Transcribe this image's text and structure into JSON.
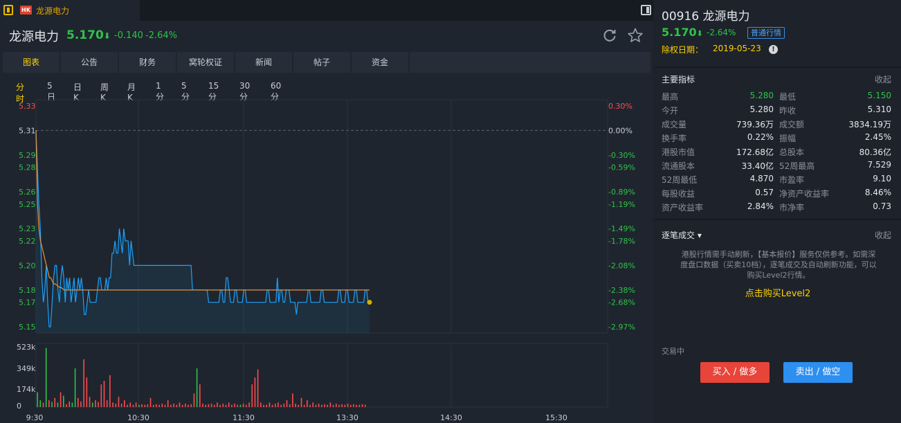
{
  "tab": {
    "badge": "HK",
    "title": "龙源电力"
  },
  "quote": {
    "name": "龙源电力",
    "price": "5.170",
    "arrow": "⬇",
    "change": "-0.140",
    "pct": "-2.64%"
  },
  "tabs": [
    "图表",
    "公告",
    "财务",
    "窝轮权证",
    "新闻",
    "帖子",
    "资金"
  ],
  "active_tab": 0,
  "periods": [
    "分时",
    "5日",
    "日K",
    "周K",
    "月K",
    "1分",
    "5分",
    "15分",
    "30分",
    "60分"
  ],
  "active_period": 0,
  "right": {
    "title": "00916 龙源电力",
    "price": "5.170",
    "arrow": "⬇",
    "pct": "-2.64%",
    "badge": "普通行情",
    "exdate_label": "除权日期：",
    "exdate": "2019-05-23",
    "info_icon": "!",
    "metrics_title": "主要指标",
    "collapse": "收起",
    "metrics": [
      [
        "最高",
        "5.280",
        "最低",
        "5.150"
      ],
      [
        "今开",
        "5.280",
        "昨收",
        "5.310"
      ],
      [
        "成交量",
        "739.36万",
        "成交额",
        "3834.19万"
      ],
      [
        "换手率",
        "0.22%",
        "振幅",
        "2.45%"
      ],
      [
        "港股市值",
        "172.68亿",
        "总股本",
        "80.36亿"
      ],
      [
        "流通股本",
        "33.40亿",
        "52周最高",
        "7.529"
      ],
      [
        "52周最低",
        "4.870",
        "市盈率",
        "9.10"
      ],
      [
        "每股收益",
        "0.57",
        "净资产收益率",
        "8.46%"
      ],
      [
        "资产收益率",
        "2.84%",
        "市净率",
        "0.73"
      ]
    ],
    "ticks_title": "逐笔成交",
    "ticks_caret": "▾",
    "ticks_collapse": "收起",
    "ticks_note": "港股行情需手动刷新，【基本报价】服务仅供参考。如需深度盘口数据（买卖10档），逐笔成交及自动刷新功能，可以购买Level2行情。",
    "buy_level2": "点击购买Level2",
    "trading": "交易中",
    "buy_btn": "买入 / 做多",
    "sell_btn": "卖出 / 做空"
  },
  "colors": {
    "up": "#ff4b4b",
    "down": "#2fc24a",
    "price_line": "#1aa3ff",
    "avg_line": "#e8913a",
    "highlight": "#ffd200"
  },
  "chart_data": {
    "type": "line",
    "price_axis": {
      "ticks": [
        "5.33",
        "5.31",
        "5.29",
        "5.28",
        "5.26",
        "5.25",
        "5.23",
        "5.22",
        "5.20",
        "5.18",
        "5.17",
        "5.15"
      ],
      "ylim": [
        5.145,
        5.335
      ]
    },
    "pct_axis": [
      "0.30%",
      "0.00%",
      "-0.30%",
      "-0.59%",
      "-0.89%",
      "-1.19%",
      "-1.49%",
      "-1.78%",
      "-2.08%",
      "-2.38%",
      "-2.68%",
      "-2.97%"
    ],
    "prev_close": 5.31,
    "time_axis": [
      "9:30",
      "10:30",
      "11:30",
      "13:30",
      "14:30",
      "15:30"
    ],
    "volume_axis": [
      "523k",
      "349k",
      "174k",
      "0"
    ],
    "volume_max": 523,
    "series": [
      {
        "values": [
          5.31,
          5.28,
          5.25,
          5.23,
          5.19,
          5.17,
          5.18,
          5.2,
          5.17,
          5.15,
          5.15,
          5.17,
          5.19,
          5.2,
          5.2,
          5.18,
          5.17,
          5.19,
          5.2,
          5.19,
          5.17,
          5.19,
          5.18,
          5.19,
          5.17,
          5.18,
          5.19,
          5.17,
          5.18,
          5.19,
          5.18,
          5.19,
          5.18,
          5.16,
          5.16,
          5.17,
          5.18,
          5.17,
          5.17,
          5.17,
          5.17,
          5.17,
          5.18,
          5.19,
          5.19,
          5.18,
          5.18,
          5.18,
          5.19,
          5.18,
          5.19,
          5.19,
          5.21,
          5.21,
          5.22,
          5.21,
          5.21,
          5.23,
          5.22,
          5.21,
          5.23,
          5.22,
          5.22,
          5.22,
          5.2,
          5.22,
          5.21,
          5.2,
          5.2,
          5.2,
          5.2,
          5.2,
          5.2,
          5.2,
          5.2,
          5.2,
          5.2,
          5.2,
          5.2,
          5.2,
          5.2,
          5.2,
          5.2,
          5.2,
          5.2,
          5.2,
          5.2,
          5.2,
          5.2,
          5.2,
          5.2,
          5.2,
          5.2,
          5.2,
          5.2,
          5.2,
          5.2,
          5.2,
          5.2,
          5.2,
          5.2,
          5.2,
          5.2,
          5.2,
          5.2,
          5.2,
          5.2,
          5.18,
          5.18,
          5.18,
          5.18,
          5.18,
          5.18,
          5.18,
          5.18,
          5.18,
          5.18,
          5.18,
          5.17,
          5.17,
          5.17,
          5.17,
          5.17,
          5.17,
          5.17,
          5.17,
          5.18,
          5.18,
          5.17,
          5.17,
          5.19,
          5.19,
          5.18,
          5.17,
          5.17,
          5.17,
          5.18,
          5.18,
          5.17,
          5.17,
          5.17,
          5.17,
          5.18,
          5.18,
          5.17,
          5.17,
          5.17,
          5.17,
          5.17,
          5.17,
          5.17,
          5.17,
          5.17,
          5.17,
          5.17,
          5.17,
          5.17,
          5.17,
          5.18,
          5.18,
          5.17,
          5.17,
          5.17,
          5.17,
          5.17,
          5.19,
          5.17,
          5.18,
          5.18,
          5.17,
          5.17,
          5.18,
          5.18,
          5.18,
          5.17,
          5.17,
          5.17,
          5.17,
          5.16,
          5.17,
          5.17,
          5.17,
          5.17,
          5.17,
          5.17,
          5.17,
          5.18,
          5.18,
          5.17,
          5.17,
          5.17,
          5.17,
          5.17,
          5.17,
          5.17,
          5.18,
          5.18,
          5.17,
          5.17,
          5.17,
          5.17,
          5.17,
          5.17,
          5.17,
          5.17,
          5.17,
          5.17,
          5.18,
          5.18,
          5.17,
          5.17,
          5.17,
          5.18,
          5.18,
          5.17,
          5.17,
          5.17,
          5.17,
          5.18,
          5.18,
          5.17,
          5.17,
          5.17,
          5.17,
          5.17,
          5.18,
          5.18,
          5.17,
          5.17
        ]
      },
      {
        "values": [
          5.31,
          5.25,
          5.23,
          5.22,
          5.215,
          5.21,
          5.205,
          5.2,
          5.195,
          5.19,
          5.19,
          5.187,
          5.185,
          5.185,
          5.184,
          5.183,
          5.182,
          5.182,
          5.181,
          5.18,
          5.18,
          5.18,
          5.18,
          5.18,
          5.18,
          5.18,
          5.18,
          5.18,
          5.18,
          5.18,
          5.18,
          5.18,
          5.18,
          5.18,
          5.18,
          5.18,
          5.18,
          5.18,
          5.18,
          5.18,
          5.18,
          5.18,
          5.18,
          5.18,
          5.18,
          5.18,
          5.18,
          5.18,
          5.18,
          5.18,
          5.18,
          5.18,
          5.18,
          5.18,
          5.18,
          5.18,
          5.18,
          5.18,
          5.18,
          5.18,
          5.18,
          5.18,
          5.18,
          5.18,
          5.18,
          5.18,
          5.18,
          5.18,
          5.18,
          5.18,
          5.18,
          5.18,
          5.18,
          5.18,
          5.18,
          5.18,
          5.18,
          5.18,
          5.18,
          5.18,
          5.18,
          5.18,
          5.18,
          5.18,
          5.18,
          5.18,
          5.18,
          5.18,
          5.18,
          5.18,
          5.18,
          5.18,
          5.18,
          5.18,
          5.18,
          5.18,
          5.18,
          5.18,
          5.18,
          5.18,
          5.18,
          5.18,
          5.18,
          5.18,
          5.18,
          5.18,
          5.18,
          5.18,
          5.18,
          5.18,
          5.18,
          5.18,
          5.18,
          5.18,
          5.18,
          5.18,
          5.18,
          5.18,
          5.18,
          5.18,
          5.18,
          5.18,
          5.18,
          5.18,
          5.18,
          5.18,
          5.18,
          5.18,
          5.18,
          5.18,
          5.18,
          5.18,
          5.18,
          5.18,
          5.18,
          5.18,
          5.18,
          5.18,
          5.18,
          5.18,
          5.18,
          5.18,
          5.18,
          5.18,
          5.18,
          5.18,
          5.18,
          5.18,
          5.18,
          5.18,
          5.18,
          5.18,
          5.18,
          5.18,
          5.18,
          5.18,
          5.18,
          5.18,
          5.18,
          5.18,
          5.18,
          5.18,
          5.18,
          5.18,
          5.18,
          5.18,
          5.18,
          5.18,
          5.18,
          5.18,
          5.18,
          5.18,
          5.18,
          5.18,
          5.18,
          5.18,
          5.18,
          5.18,
          5.18,
          5.18,
          5.18,
          5.18,
          5.18,
          5.18,
          5.18,
          5.18,
          5.18,
          5.18,
          5.18,
          5.18,
          5.18,
          5.18,
          5.18,
          5.18,
          5.18,
          5.18,
          5.18,
          5.18,
          5.18,
          5.18,
          5.18,
          5.18,
          5.18,
          5.18,
          5.18,
          5.18,
          5.18,
          5.18,
          5.18,
          5.18,
          5.18,
          5.18,
          5.18,
          5.18,
          5.18,
          5.18,
          5.18,
          5.18,
          5.18,
          5.18,
          5.18,
          5.18,
          5.18,
          5.18,
          5.18
        ]
      }
    ],
    "volume": [
      [
        1,
        130,
        "down"
      ],
      [
        3,
        60,
        "down"
      ],
      [
        5,
        40,
        "up"
      ],
      [
        7,
        520,
        "down"
      ],
      [
        9,
        60,
        "up"
      ],
      [
        11,
        45,
        "down"
      ],
      [
        13,
        80,
        "up"
      ],
      [
        15,
        40,
        "down"
      ],
      [
        17,
        130,
        "up"
      ],
      [
        19,
        100,
        "down"
      ],
      [
        21,
        25,
        "up"
      ],
      [
        23,
        50,
        "up"
      ],
      [
        25,
        40,
        "down"
      ],
      [
        27,
        340,
        "down"
      ],
      [
        29,
        80,
        "up"
      ],
      [
        31,
        50,
        "up"
      ],
      [
        33,
        420,
        "up"
      ],
      [
        35,
        260,
        "up"
      ],
      [
        37,
        90,
        "up"
      ],
      [
        39,
        40,
        "down"
      ],
      [
        41,
        60,
        "up"
      ],
      [
        43,
        45,
        "up"
      ],
      [
        45,
        200,
        "up"
      ],
      [
        47,
        230,
        "up"
      ],
      [
        49,
        60,
        "up"
      ],
      [
        51,
        280,
        "up"
      ],
      [
        53,
        40,
        "up"
      ],
      [
        55,
        30,
        "up"
      ],
      [
        57,
        90,
        "up"
      ],
      [
        59,
        30,
        "up"
      ],
      [
        61,
        60,
        "up"
      ],
      [
        63,
        20,
        "up"
      ],
      [
        65,
        40,
        "up"
      ],
      [
        67,
        20,
        "up"
      ],
      [
        69,
        40,
        "up"
      ],
      [
        71,
        20,
        "down"
      ],
      [
        73,
        25,
        "up"
      ],
      [
        75,
        20,
        "up"
      ],
      [
        77,
        25,
        "up"
      ],
      [
        79,
        80,
        "up"
      ],
      [
        81,
        20,
        "up"
      ],
      [
        83,
        25,
        "up"
      ],
      [
        85,
        20,
        "up"
      ],
      [
        87,
        30,
        "up"
      ],
      [
        89,
        20,
        "up"
      ],
      [
        91,
        60,
        "up"
      ],
      [
        93,
        20,
        "up"
      ],
      [
        95,
        30,
        "up"
      ],
      [
        97,
        20,
        "up"
      ],
      [
        99,
        40,
        "up"
      ],
      [
        101,
        20,
        "up"
      ],
      [
        103,
        30,
        "up"
      ],
      [
        105,
        20,
        "up"
      ],
      [
        107,
        25,
        "up"
      ],
      [
        109,
        120,
        "up"
      ],
      [
        111,
        340,
        "down"
      ],
      [
        113,
        200,
        "up"
      ],
      [
        115,
        30,
        "up"
      ],
      [
        117,
        20,
        "up"
      ],
      [
        119,
        25,
        "up"
      ],
      [
        121,
        30,
        "up"
      ],
      [
        123,
        20,
        "up"
      ],
      [
        125,
        40,
        "up"
      ],
      [
        127,
        20,
        "up"
      ],
      [
        129,
        30,
        "up"
      ],
      [
        131,
        20,
        "up"
      ],
      [
        133,
        40,
        "up"
      ],
      [
        135,
        20,
        "up"
      ],
      [
        137,
        30,
        "up"
      ],
      [
        139,
        20,
        "up"
      ],
      [
        141,
        20,
        "down"
      ],
      [
        143,
        30,
        "up"
      ],
      [
        145,
        20,
        "up"
      ],
      [
        147,
        40,
        "up"
      ],
      [
        149,
        200,
        "up"
      ],
      [
        151,
        260,
        "up"
      ],
      [
        153,
        330,
        "up"
      ],
      [
        155,
        40,
        "up"
      ],
      [
        157,
        20,
        "up"
      ],
      [
        159,
        20,
        "up"
      ],
      [
        161,
        40,
        "up"
      ],
      [
        163,
        20,
        "up"
      ],
      [
        165,
        30,
        "up"
      ],
      [
        167,
        40,
        "up"
      ],
      [
        169,
        20,
        "up"
      ],
      [
        171,
        30,
        "up"
      ],
      [
        173,
        60,
        "up"
      ],
      [
        175,
        25,
        "up"
      ],
      [
        177,
        120,
        "up"
      ],
      [
        179,
        30,
        "up"
      ],
      [
        181,
        20,
        "up"
      ],
      [
        183,
        80,
        "up"
      ],
      [
        185,
        20,
        "up"
      ],
      [
        187,
        60,
        "up"
      ],
      [
        189,
        20,
        "up"
      ],
      [
        191,
        40,
        "up"
      ],
      [
        193,
        20,
        "up"
      ],
      [
        195,
        30,
        "up"
      ],
      [
        197,
        20,
        "up"
      ],
      [
        199,
        25,
        "up"
      ],
      [
        201,
        20,
        "up"
      ],
      [
        203,
        40,
        "up"
      ],
      [
        205,
        20,
        "up"
      ],
      [
        207,
        30,
        "up"
      ],
      [
        209,
        20,
        "up"
      ],
      [
        211,
        25,
        "up"
      ],
      [
        213,
        20,
        "up"
      ],
      [
        215,
        30,
        "up"
      ],
      [
        217,
        20,
        "up"
      ],
      [
        219,
        25,
        "up"
      ],
      [
        221,
        20,
        "up"
      ],
      [
        223,
        20,
        "up"
      ],
      [
        225,
        25,
        "up"
      ],
      [
        227,
        20,
        "up"
      ]
    ]
  }
}
